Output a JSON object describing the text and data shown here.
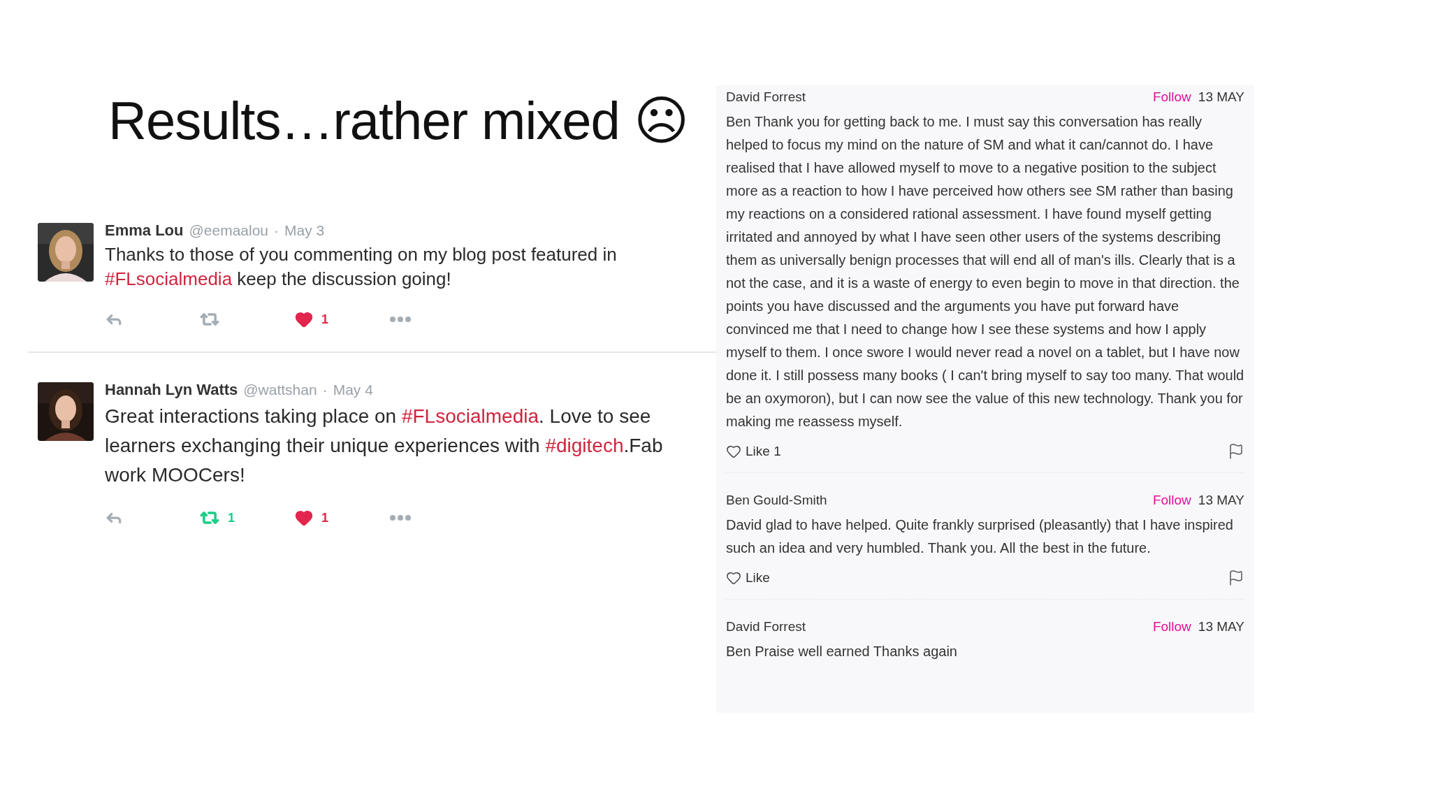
{
  "title": "Results…rather mixed ☹",
  "tweets": [
    {
      "name": "Emma Lou",
      "handle": "@eemaalou",
      "separator": "·",
      "date": "May 3",
      "segments": [
        {
          "kind": "plain",
          "text": "Thanks to those of you commenting on my blog post featured in "
        },
        {
          "kind": "hashtag",
          "text": "#FLsocialmedia"
        },
        {
          "kind": "plain",
          "text": " keep the discussion going!"
        }
      ],
      "retweeted": false,
      "liked": true,
      "like_count": "1"
    },
    {
      "name": "Hannah Lyn Watts",
      "handle": "@wattshan",
      "separator": "·",
      "date": "May 4",
      "segments": [
        {
          "kind": "plain",
          "text": "Great interactions taking place on "
        },
        {
          "kind": "hashtag",
          "text": "#FLsocialmedia"
        },
        {
          "kind": "plain",
          "text": ". Love to see learners exchanging their unique experiences with "
        },
        {
          "kind": "hashtag",
          "text": "#digitech"
        },
        {
          "kind": "plain",
          "text": ".Fab work MOOCers!"
        }
      ],
      "retweeted": true,
      "retweet_count": "1",
      "liked": true,
      "like_count": "1"
    }
  ],
  "comments": [
    {
      "author": "David Forrest",
      "follow": "Follow",
      "date": "13 MAY",
      "text": "Ben Thank you for getting back to me. I must say this conversation has really helped to focus my mind on the nature of SM and what it can/cannot do. I have realised that I have allowed myself to move to a negative position to the subject more as a reaction to how I have perceived how others see SM rather than basing my reactions on a considered rational assessment. I have found myself getting irritated and annoyed by what I have seen other users of the systems describing them as universally benign processes that will end all of man's ills. Clearly that is a not the case, and it is a waste of energy to even begin to move in that direction. the points you have discussed and the arguments you have put forward have convinced me that I need to change how I see these systems and how I apply myself to them. I once swore I would never read a novel on a tablet, but I have now done it. I still possess many books ( I can't bring myself to say too many. That would be an oxymoron), but I can now see the value of this new technology. Thank you for making me reassess myself.",
      "like": "Like 1"
    },
    {
      "author": "Ben Gould-Smith",
      "follow": "Follow",
      "date": "13 MAY",
      "text": "David glad to have helped. Quite frankly surprised (pleasantly) that I have inspired such an idea and very humbled. Thank you. All the best in the future.",
      "like": "Like"
    },
    {
      "author": "David Forrest",
      "follow": "Follow",
      "date": "13 MAY",
      "text": "Ben Praise well earned Thanks again"
    }
  ]
}
